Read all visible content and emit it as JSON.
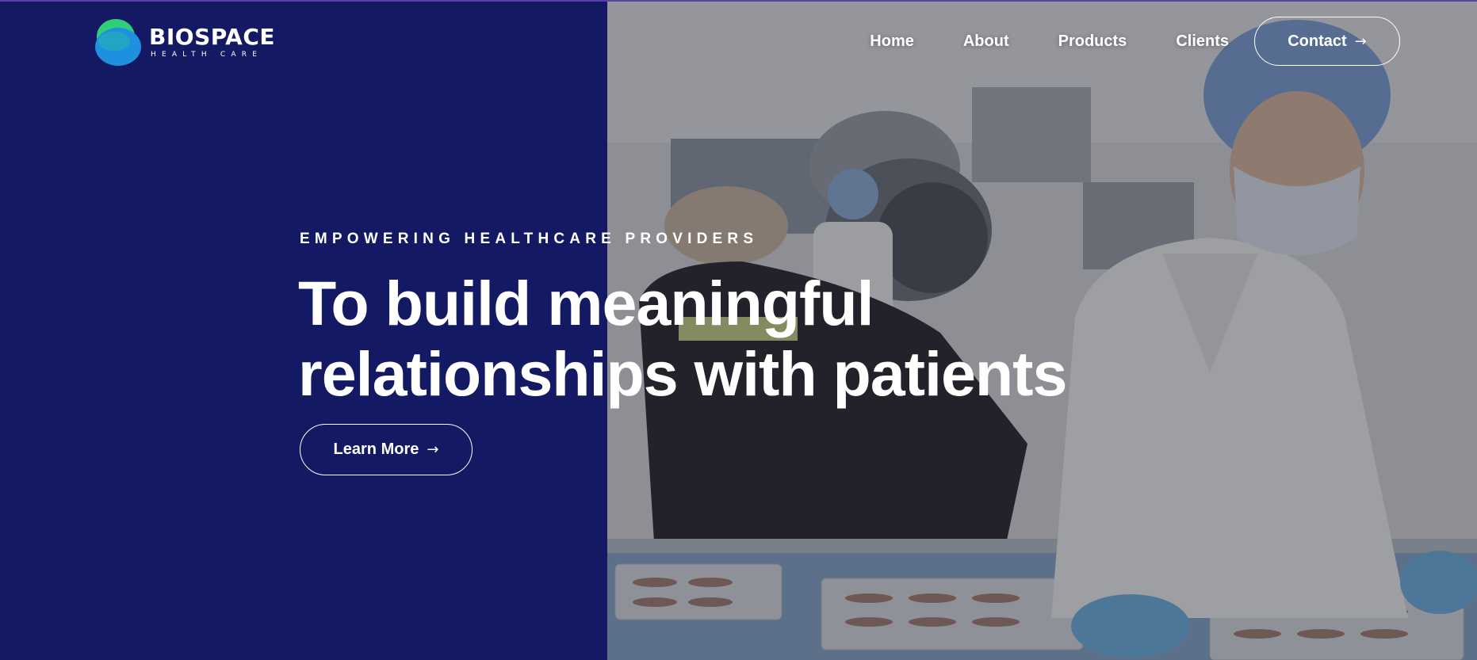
{
  "brand": {
    "name": "BIOSPACE",
    "tagline": "HEALTH CARE",
    "logo_colors": [
      "#2fcf7a",
      "#1f8fe0"
    ]
  },
  "nav": {
    "items": [
      {
        "label": "Home"
      },
      {
        "label": "About"
      },
      {
        "label": "Products"
      },
      {
        "label": "Clients"
      }
    ],
    "contact_label": "Contact",
    "contact_icon": "arrow-right-icon"
  },
  "hero": {
    "eyebrow": "EMPOWERING HEALTHCARE PROVIDERS",
    "headline_line1": "To build meaningful",
    "headline_line2": "relationships with patients",
    "cta_label": "Learn More",
    "cta_icon": "arrow-right-icon",
    "image_description_icon": "lab-workers-photo"
  },
  "colors": {
    "navy": "#131a63",
    "text": "#ffffff",
    "accent_line": "#5b3fa8"
  }
}
